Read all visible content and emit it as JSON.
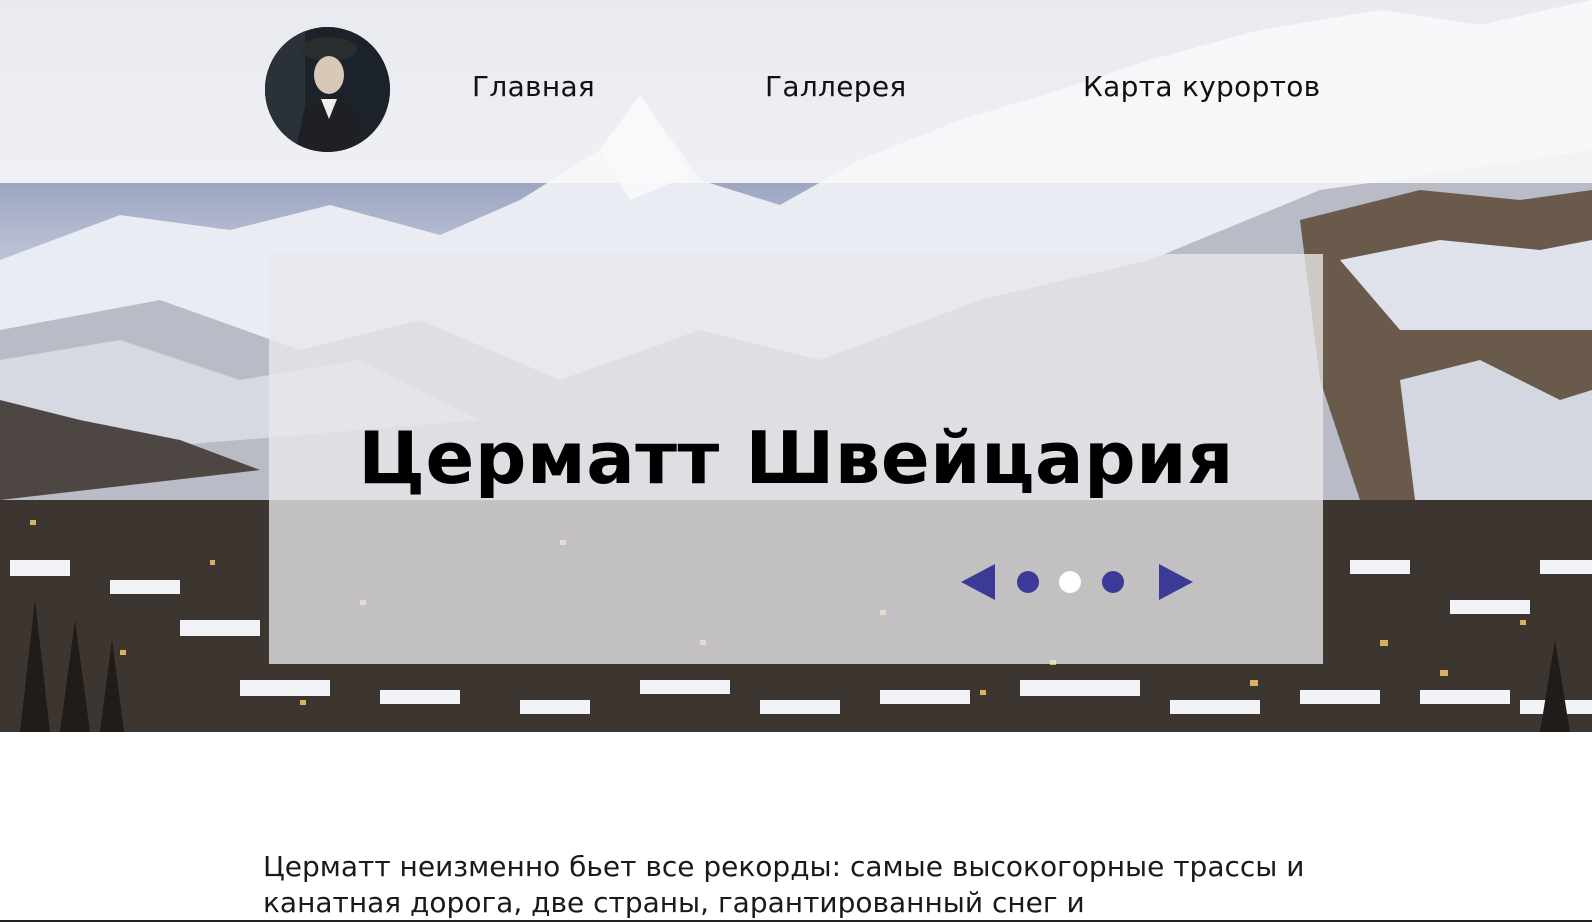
{
  "header": {
    "nav": [
      {
        "label": "Главная"
      },
      {
        "label": "Галлерея"
      },
      {
        "label": "Карта курортов"
      }
    ]
  },
  "hero": {
    "title": "Церматт Швейцария",
    "slider": {
      "total_slides": 3,
      "active_slide": 2,
      "prev_icon": "triangle-left-icon",
      "next_icon": "triangle-right-icon"
    }
  },
  "content": {
    "intro_text": "Церматт неизменно бьет все рекорды: самые высокогорные трассы и канатная дорога, две страны, гарантированный снег и"
  },
  "colors": {
    "accent": "#3b3a96",
    "dot_active": "#ffffff",
    "header_band": "#f8f8fa",
    "card": "#e8e8ea"
  }
}
